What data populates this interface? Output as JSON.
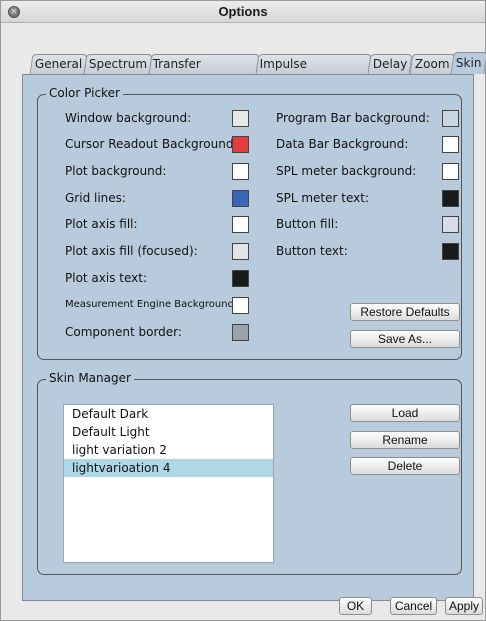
{
  "window": {
    "title": "Options",
    "close_glyph": "×"
  },
  "tabs": [
    {
      "label": "General"
    },
    {
      "label": "Spectrum"
    },
    {
      "label": "Transfer Function"
    },
    {
      "label": "Impulse Response"
    },
    {
      "label": "Delay"
    },
    {
      "label": "Zoom"
    },
    {
      "label": "Skin",
      "active": true
    }
  ],
  "color_picker": {
    "title": "Color Picker",
    "left": [
      {
        "label": "Window background:",
        "color": "#e8e8e8"
      },
      {
        "label": "Cursor Readout Background:",
        "color": "#e23c3c"
      },
      {
        "label": "Plot background:",
        "color": "#ffffff"
      },
      {
        "label": "Grid lines:",
        "color": "#3a66b5"
      },
      {
        "label": "Plot axis fill:",
        "color": "#ffffff"
      },
      {
        "label": "Plot axis fill (focused):",
        "color": "#e0e4e8"
      },
      {
        "label": "Plot axis text:",
        "color": "#1a1a1a"
      },
      {
        "label": "Measurement Engine Background:",
        "color": "#ffffff"
      },
      {
        "label": "Component border:",
        "color": "#9aa3ab"
      }
    ],
    "right": [
      {
        "label": "Program Bar background:",
        "color": "#c9d6e2"
      },
      {
        "label": "Data Bar Background:",
        "color": "#ffffff"
      },
      {
        "label": "SPL meter background:",
        "color": "#ffffff"
      },
      {
        "label": "SPL meter text:",
        "color": "#1a1a1a"
      },
      {
        "label": "Button fill:",
        "color": "#d8dce6"
      },
      {
        "label": "Button text:",
        "color": "#1a1a1a"
      }
    ],
    "restore_label": "Restore Defaults",
    "save_as_label": "Save As..."
  },
  "skin_manager": {
    "title": "Skin Manager",
    "skins": [
      {
        "label": "Default Dark"
      },
      {
        "label": "Default Light"
      },
      {
        "label": "light variation 2"
      },
      {
        "label": "lightvarioation 4",
        "selected": true
      }
    ],
    "load_label": "Load",
    "rename_label": "Rename",
    "delete_label": "Delete"
  },
  "footer": {
    "ok_label": "OK",
    "cancel_label": "Cancel",
    "apply_label": "Apply"
  }
}
